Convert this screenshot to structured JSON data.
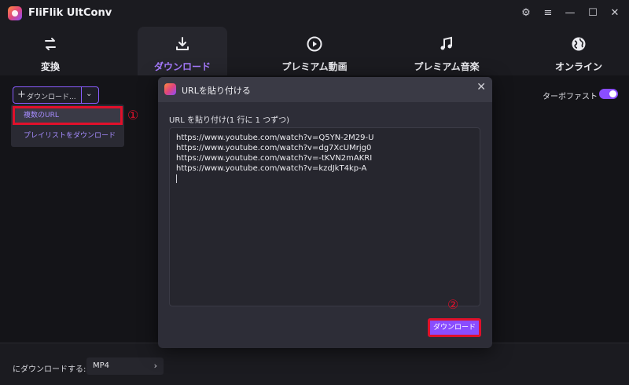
{
  "app": {
    "title": "FliFlik UltConv"
  },
  "window_controls": {
    "settings": "⚙",
    "menu": "≡",
    "minimize": "—",
    "maximize": "☐",
    "close": "✕"
  },
  "nav": {
    "tabs": [
      {
        "label": "変換",
        "icon": "convert-arrows-icon"
      },
      {
        "label": "ダウンロード",
        "icon": "download-icon"
      },
      {
        "label": "プレミアム動画",
        "icon": "play-circle-icon"
      },
      {
        "label": "プレミアム音楽",
        "icon": "music-note-icon"
      },
      {
        "label": "オンライン",
        "icon": "globe-icon"
      }
    ],
    "active": 1
  },
  "toolbar": {
    "download_button": "ダウンロード...",
    "turbo_label": "ターボファスト",
    "turbo_enabled": true
  },
  "dropdown_menu": {
    "items": [
      "複数のURL",
      "プレイリストをダウンロード"
    ],
    "highlighted": 0
  },
  "annotations": {
    "marker1": "①",
    "marker2": "②"
  },
  "dialog": {
    "title": "URLを貼り付ける",
    "label": "URL を貼り付け(1 行に 1 つずつ)",
    "urls": [
      "https://www.youtube.com/watch?v=Q5YN-2M29-U",
      "https://www.youtube.com/watch?v=dg7XcUMrjg0",
      "https://www.youtube.com/watch?v=-tKVN2mAKRI",
      "https://www.youtube.com/watch?v=kzdJkT4kp-A"
    ],
    "download_button": "ダウンロード"
  },
  "footer": {
    "label": "にダウンロードする:",
    "format": "MP4"
  },
  "colors": {
    "accent": "#8a4dff",
    "highlight": "#e0102b",
    "background": "#141418"
  }
}
